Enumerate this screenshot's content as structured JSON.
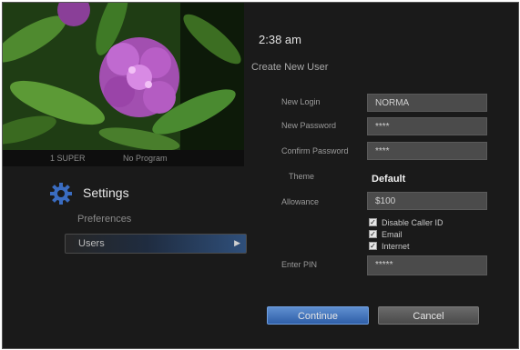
{
  "clock": "2:38 am",
  "form_title": "Create New User",
  "preview_info": {
    "channel": "1 SUPER",
    "program": "No Program"
  },
  "settings": {
    "title": "Settings",
    "items": [
      "Preferences",
      "Users"
    ]
  },
  "fields": {
    "new_login": {
      "label": "New Login",
      "value": "NORMA"
    },
    "new_password": {
      "label": "New Password",
      "value": "****"
    },
    "confirm_password": {
      "label": "Confirm Password",
      "value": "****"
    },
    "theme": {
      "label": "Theme",
      "value": "Default"
    },
    "allowance": {
      "label": "Allowance",
      "value": "$100"
    },
    "enter_pin": {
      "label": "Enter PIN",
      "value": "*****"
    }
  },
  "checkboxes": [
    {
      "label": "Disable Caller ID",
      "checked": true
    },
    {
      "label": "Email",
      "checked": true
    },
    {
      "label": "Internet",
      "checked": true
    }
  ],
  "buttons": {
    "continue": "Continue",
    "cancel": "Cancel"
  },
  "colors": {
    "accent": "#3a6cc0",
    "background": "#1a1a1a",
    "field": "#4b4b4b"
  }
}
